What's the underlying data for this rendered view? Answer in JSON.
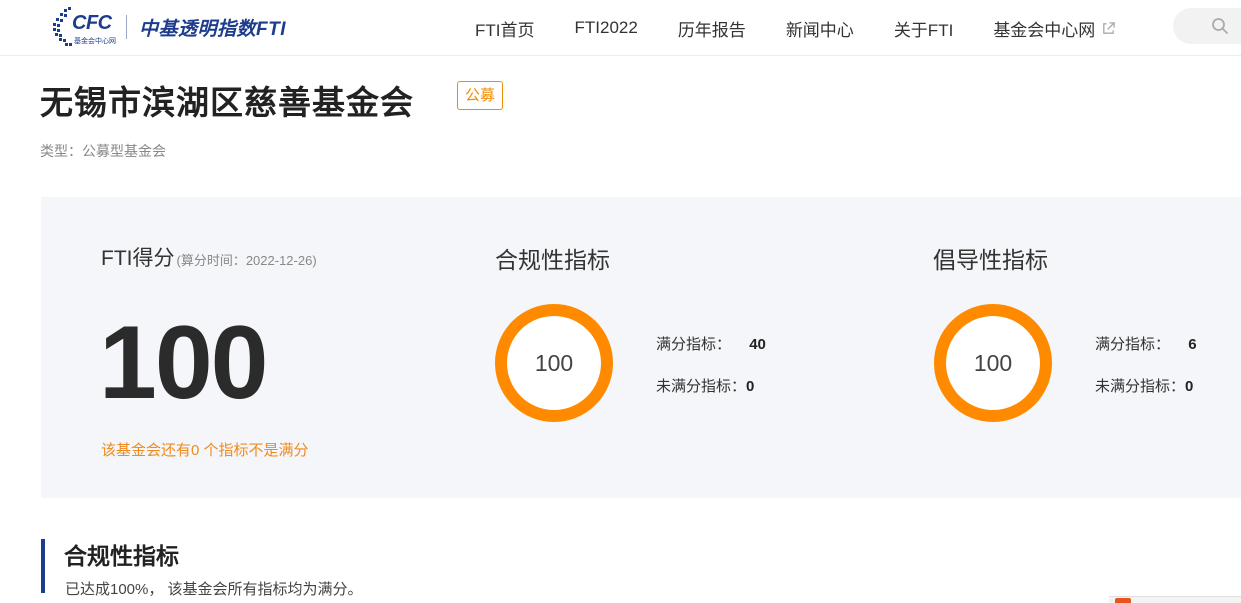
{
  "header": {
    "logo_text": "CFC",
    "logo_subtext": "基金会中心网",
    "logo_title": "中基透明指数FTI",
    "nav": [
      {
        "label": "FTI首页"
      },
      {
        "label": "FTI2022"
      },
      {
        "label": "历年报告"
      },
      {
        "label": "新闻中心"
      },
      {
        "label": "关于FTI"
      },
      {
        "label": "基金会中心网"
      }
    ],
    "search_icon": "search-icon",
    "external_icon": "external-link-icon"
  },
  "foundation": {
    "name": "无锡市滨湖区慈善基金会",
    "badge": "公募",
    "type_line": "类型：公募型基金会"
  },
  "score": {
    "label": "FTI得分",
    "time": "(算分时间：2022-12-26)",
    "value": "100",
    "note": "该基金会还有0 个指标不是满分"
  },
  "metrics": [
    {
      "title": "合规性指标",
      "ring_value": "100",
      "full_label": "满分指标：",
      "full_count": "40",
      "not_full_label": "未满分指标：",
      "not_full_count": "0"
    },
    {
      "title": "倡导性指标",
      "ring_value": "100",
      "full_label": "满分指标：",
      "full_count": "6",
      "not_full_label": "未满分指标：",
      "not_full_count": "0"
    }
  ],
  "section": {
    "title": "合规性指标",
    "desc": "已达成100%， 该基金会所有指标均为满分。"
  },
  "colors": {
    "brand": "#1e3c8c",
    "accent": "#f08c00",
    "ring": "#ff8a00",
    "panel_bg": "#f4f6f9"
  }
}
